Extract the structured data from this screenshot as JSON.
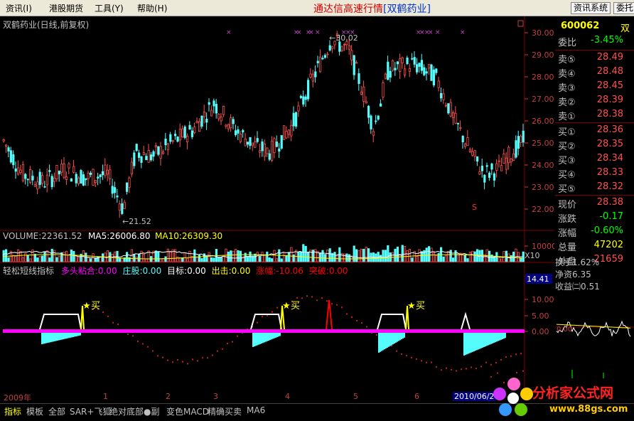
{
  "menu": {
    "items": [
      "资讯(I)",
      "港股期货",
      "工具(Y)",
      "帮助(H)"
    ],
    "app_title": "通达信高速行情",
    "stock_tag": "[双鹤药业]",
    "right_buttons": [
      "资讯系统",
      "委托"
    ]
  },
  "main_chart": {
    "title": "双鹤药业(日线,前复权)",
    "y_ticks": [
      "30.00",
      "29.00",
      "28.00",
      "27.00",
      "26.00",
      "25.00",
      "24.00",
      "23.00",
      "22.00"
    ],
    "high_marker": "30.02",
    "low_marker": "21.52",
    "s_marker": "S",
    "colors": {
      "up": "#ff5050",
      "down": "#54fcfc",
      "axis": "#c04040"
    }
  },
  "volume": {
    "volume_label": "VOLUME:22361.52",
    "ma5_label": "MA5:26006.80",
    "ma10_label": "MA10:26309.30",
    "y_tick": "10000",
    "unit": "X10"
  },
  "indicator": {
    "name": "轻松短线指标",
    "items": [
      {
        "label": "多头粘合:0.00",
        "color": "#ff00ff"
      },
      {
        "label": "庄股:0.00",
        "color": "#54fcfc"
      },
      {
        "label": "目标:0.00",
        "color": "#ffffff"
      },
      {
        "label": "出击:0.00",
        "color": "#ffff00"
      },
      {
        "label": "涨幅:-10.06",
        "color": "#ff0000"
      },
      {
        "label": "突破:0.00",
        "color": "#ff0000"
      }
    ],
    "y_ticks": [
      "14.41",
      "10.00",
      "5.00",
      "0.00"
    ],
    "buy_label": "买"
  },
  "quote": {
    "code": "600062",
    "name_short": "双",
    "webi_label": "委比",
    "webi_value": "-3.45%",
    "sell": [
      {
        "label": "卖⑤",
        "value": "28.49"
      },
      {
        "label": "卖④",
        "value": "28.48"
      },
      {
        "label": "卖③",
        "value": "28.45"
      },
      {
        "label": "卖②",
        "value": "28.39"
      },
      {
        "label": "卖①",
        "value": "28.38"
      }
    ],
    "buy": [
      {
        "label": "买①",
        "value": "28.36"
      },
      {
        "label": "买②",
        "value": "28.35"
      },
      {
        "label": "买③",
        "value": "28.34"
      },
      {
        "label": "买④",
        "value": "28.33"
      },
      {
        "label": "买⑤",
        "value": "28.32"
      }
    ],
    "stats": [
      {
        "label": "现价",
        "value": "28.38",
        "color": "#ff5050"
      },
      {
        "label": "涨跌",
        "value": "-0.17",
        "color": "#00ff00"
      },
      {
        "label": "涨幅",
        "value": "-0.60%",
        "color": "#00ff00"
      },
      {
        "label": "总量",
        "value": "47202",
        "color": "#ffff00"
      },
      {
        "label": "外盘",
        "value": "21659",
        "color": "#ff5050"
      }
    ],
    "stats2": [
      {
        "label": "换手",
        "value": "1.62%"
      },
      {
        "label": "净资",
        "value": "6.35"
      },
      {
        "label": "收益㈡",
        "value": "0.51"
      }
    ],
    "mini_tick": "0.00"
  },
  "timeline": {
    "labels": [
      "2009年",
      "1",
      "2",
      "3",
      "4",
      "5",
      "6",
      "2010/06/2"
    ]
  },
  "tabs": [
    "指标",
    "模板",
    "全部",
    "SAR+飞狐",
    "绝对底部●副",
    "变色MACD",
    "精确买卖",
    "MA6"
  ],
  "watermark": {
    "text": "分析家公式网",
    "url": "www.88gs.com"
  }
}
